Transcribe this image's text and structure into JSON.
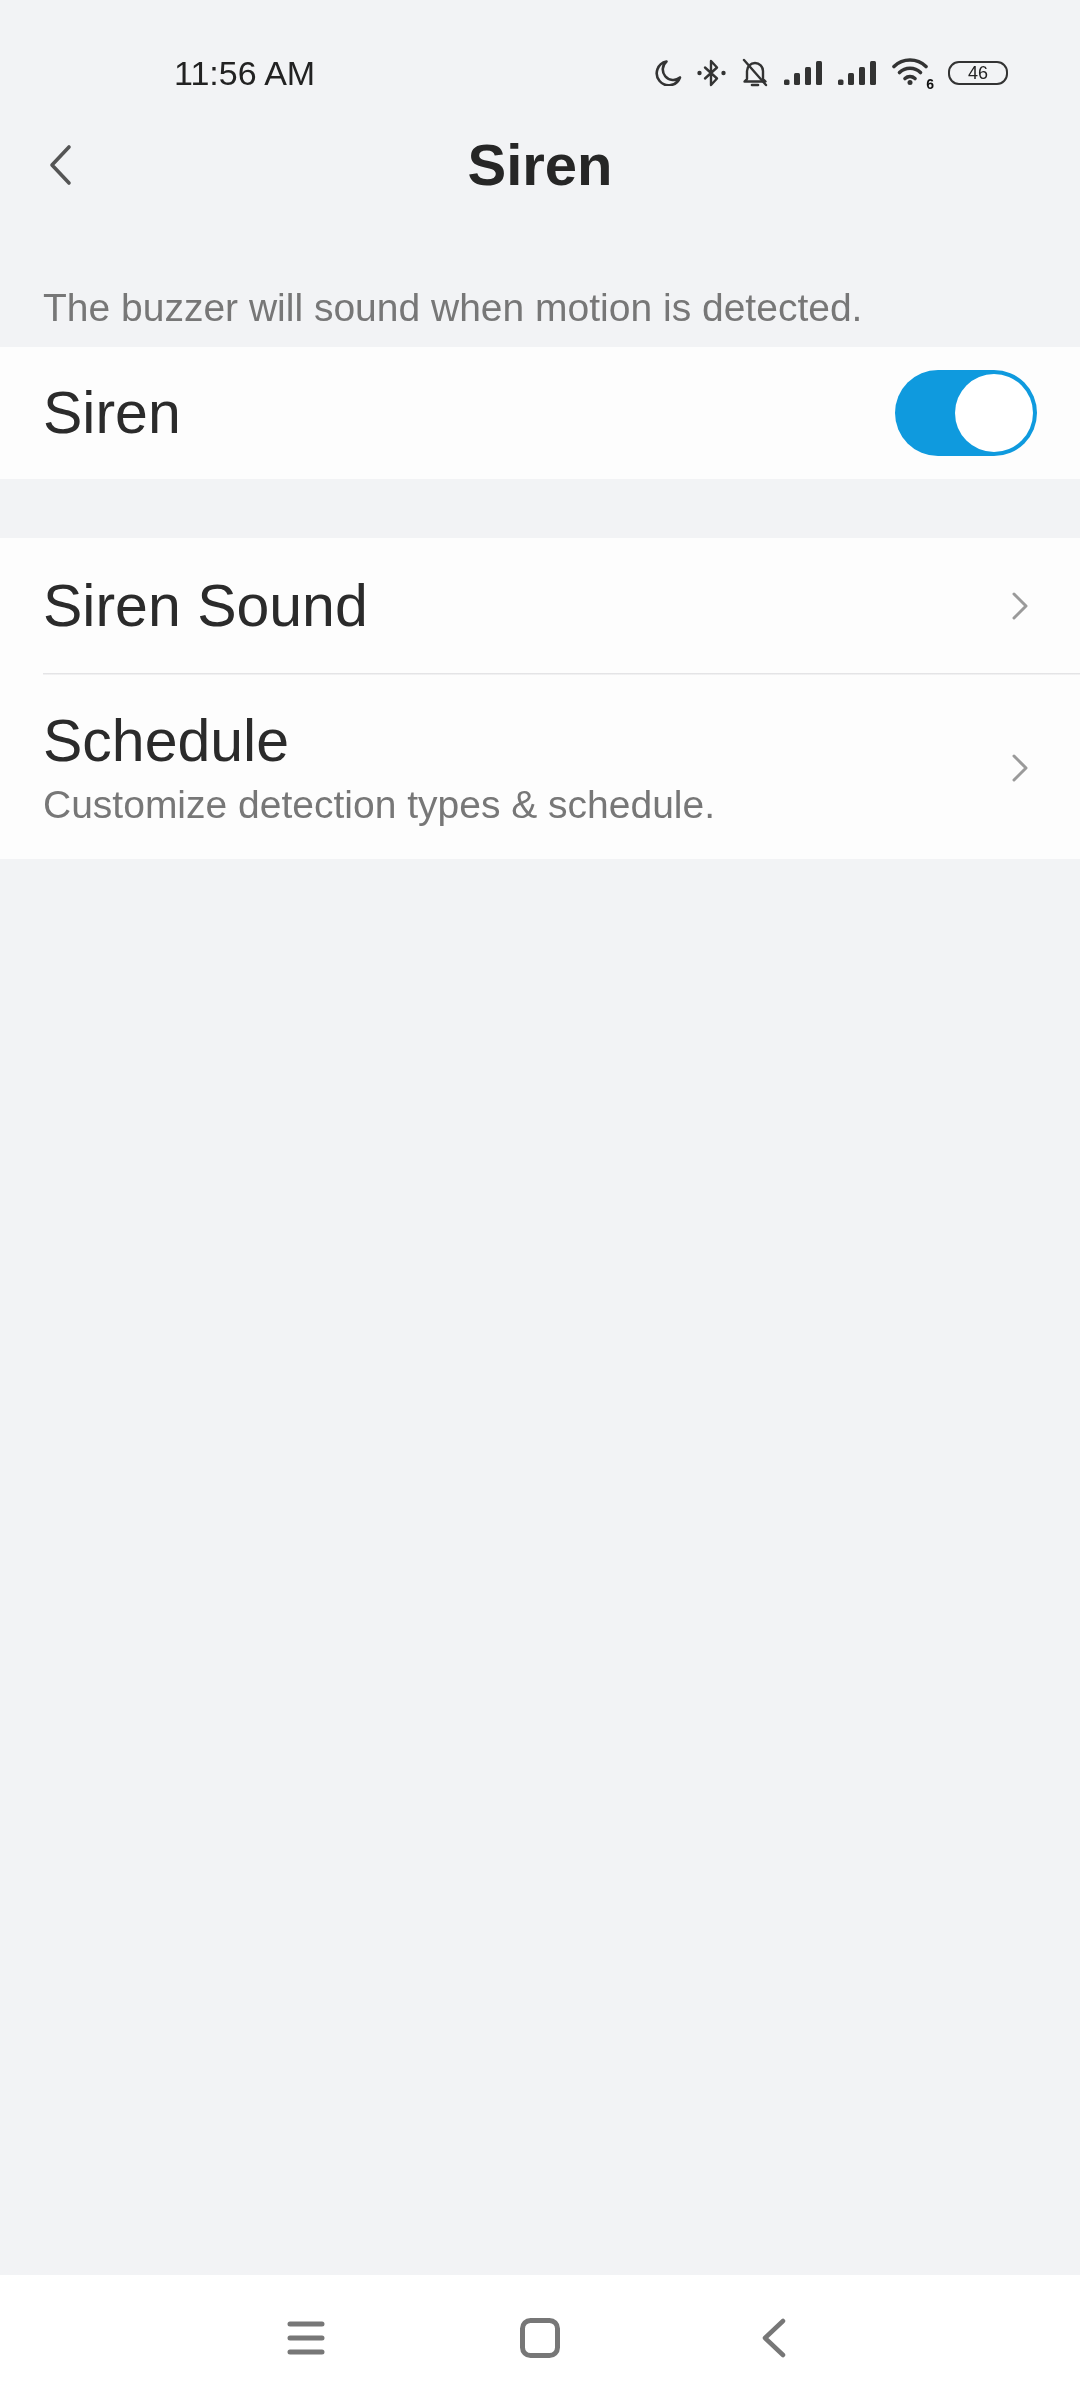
{
  "status_bar": {
    "time": "11:56 AM",
    "wifi_badge": "6",
    "battery": "46"
  },
  "header": {
    "title": "Siren"
  },
  "description": "The buzzer will sound when motion is detected.",
  "groups": [
    {
      "items": [
        {
          "kind": "toggle",
          "label": "Siren",
          "on": true
        }
      ]
    },
    {
      "items": [
        {
          "kind": "link",
          "label": "Siren Sound"
        },
        {
          "kind": "link",
          "label": "Schedule",
          "subtitle": "Customize detection types & schedule."
        }
      ]
    }
  ]
}
